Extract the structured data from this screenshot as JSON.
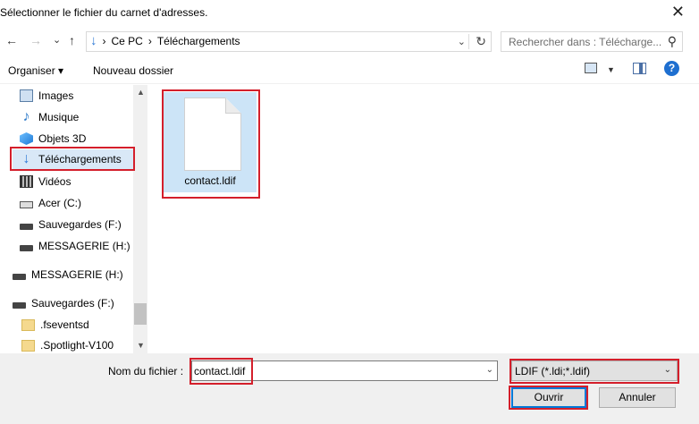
{
  "window": {
    "title": "Sélectionner le fichier du carnet d'adresses.",
    "close_glyph": "✕"
  },
  "nav": {
    "back": "←",
    "forward": "→",
    "recent": "⌄",
    "up": "↑"
  },
  "address": {
    "icon": "downloads-arrow-icon",
    "separator": "›",
    "crumbs": [
      "Ce PC",
      "Téléchargements"
    ],
    "dropdown": "⌄",
    "refresh": "↻"
  },
  "search": {
    "placeholder": "Rechercher dans : Télécharge...",
    "icon": "⚲"
  },
  "toolbar": {
    "organize_label": "Organiser ▾",
    "new_folder_label": "Nouveau dossier",
    "view_dd": "▼",
    "help": "?"
  },
  "sidebar": {
    "items": [
      {
        "label": "Images",
        "icon": "images-icon"
      },
      {
        "label": "Musique",
        "icon": "music-icon"
      },
      {
        "label": "Objets 3D",
        "icon": "objects-3d-icon"
      },
      {
        "label": "Téléchargements",
        "icon": "downloads-icon",
        "selected": true
      },
      {
        "label": "Vidéos",
        "icon": "videos-icon"
      },
      {
        "label": "Acer (C:)",
        "icon": "disk-icon"
      },
      {
        "label": "Sauvegardes (F:)",
        "icon": "drive-icon"
      },
      {
        "label": "MESSAGERIE (H:)",
        "icon": "drive-icon"
      },
      {
        "label": "MESSAGERIE (H:)",
        "icon": "drive-icon"
      },
      {
        "label": "Sauvegardes (F:)",
        "icon": "drive-icon"
      },
      {
        "label": ".fseventsd",
        "icon": "folder-icon"
      },
      {
        "label": ".Spotlight-V100",
        "icon": "folder-icon"
      }
    ],
    "scroll_up": "▲",
    "scroll_down": "▼"
  },
  "files": [
    {
      "name": "contact.ldif",
      "icon": "file-icon",
      "selected": true
    }
  ],
  "footer": {
    "filename_label": "Nom du fichier :",
    "filename_value": "contact.ldif",
    "filetype_value": "LDIF (*.ldi;*.ldif)",
    "dropdown": "⌄",
    "open_label": "Ouvrir",
    "cancel_label": "Annuler"
  },
  "highlight_color": "#d41f2b",
  "selection_color": "#cce4f7"
}
